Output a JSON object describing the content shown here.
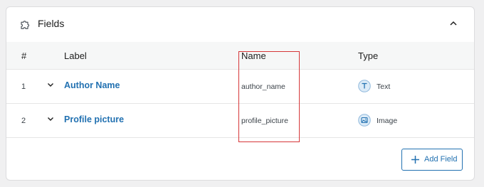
{
  "card": {
    "title": "Fields",
    "icon": "puzzle-icon",
    "collapse_icon": "chevron-up-icon"
  },
  "table": {
    "headers": {
      "number": "#",
      "label": "Label",
      "name": "Name",
      "type": "Type"
    },
    "rows": [
      {
        "number": "1",
        "label": "Author Name",
        "name": "author_name",
        "type": "Text",
        "type_icon": "text-type-icon"
      },
      {
        "number": "2",
        "label": "Profile picture",
        "name": "profile_picture",
        "type": "Image",
        "type_icon": "image-type-icon"
      }
    ]
  },
  "actions": {
    "add_field_label": "Add Field"
  },
  "colors": {
    "accent": "#2271b1",
    "highlight": "#d63638",
    "background": "#f0f0f1"
  }
}
